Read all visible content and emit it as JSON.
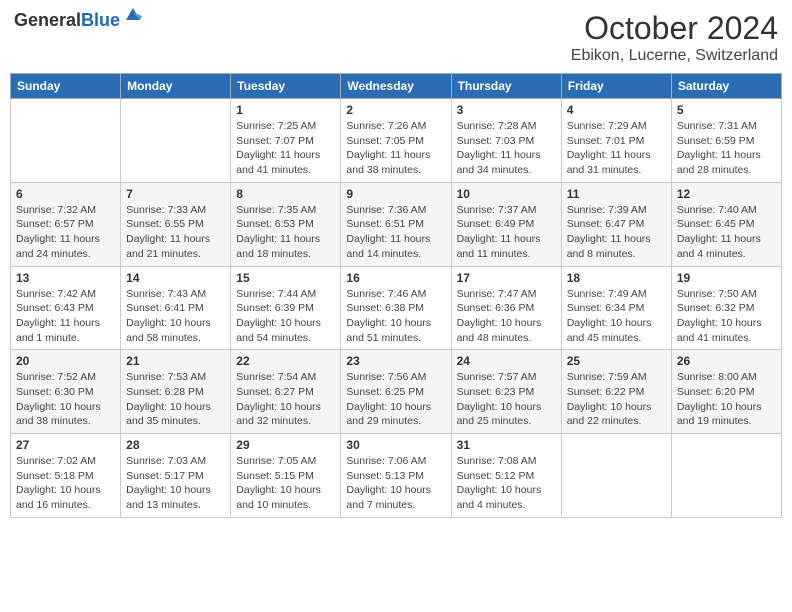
{
  "header": {
    "logo_general": "General",
    "logo_blue": "Blue",
    "month": "October 2024",
    "location": "Ebikon, Lucerne, Switzerland"
  },
  "weekdays": [
    "Sunday",
    "Monday",
    "Tuesday",
    "Wednesday",
    "Thursday",
    "Friday",
    "Saturday"
  ],
  "weeks": [
    [
      {
        "day": "",
        "sunrise": "",
        "sunset": "",
        "daylight": ""
      },
      {
        "day": "",
        "sunrise": "",
        "sunset": "",
        "daylight": ""
      },
      {
        "day": "1",
        "sunrise": "Sunrise: 7:25 AM",
        "sunset": "Sunset: 7:07 PM",
        "daylight": "Daylight: 11 hours and 41 minutes."
      },
      {
        "day": "2",
        "sunrise": "Sunrise: 7:26 AM",
        "sunset": "Sunset: 7:05 PM",
        "daylight": "Daylight: 11 hours and 38 minutes."
      },
      {
        "day": "3",
        "sunrise": "Sunrise: 7:28 AM",
        "sunset": "Sunset: 7:03 PM",
        "daylight": "Daylight: 11 hours and 34 minutes."
      },
      {
        "day": "4",
        "sunrise": "Sunrise: 7:29 AM",
        "sunset": "Sunset: 7:01 PM",
        "daylight": "Daylight: 11 hours and 31 minutes."
      },
      {
        "day": "5",
        "sunrise": "Sunrise: 7:31 AM",
        "sunset": "Sunset: 6:59 PM",
        "daylight": "Daylight: 11 hours and 28 minutes."
      }
    ],
    [
      {
        "day": "6",
        "sunrise": "Sunrise: 7:32 AM",
        "sunset": "Sunset: 6:57 PM",
        "daylight": "Daylight: 11 hours and 24 minutes."
      },
      {
        "day": "7",
        "sunrise": "Sunrise: 7:33 AM",
        "sunset": "Sunset: 6:55 PM",
        "daylight": "Daylight: 11 hours and 21 minutes."
      },
      {
        "day": "8",
        "sunrise": "Sunrise: 7:35 AM",
        "sunset": "Sunset: 6:53 PM",
        "daylight": "Daylight: 11 hours and 18 minutes."
      },
      {
        "day": "9",
        "sunrise": "Sunrise: 7:36 AM",
        "sunset": "Sunset: 6:51 PM",
        "daylight": "Daylight: 11 hours and 14 minutes."
      },
      {
        "day": "10",
        "sunrise": "Sunrise: 7:37 AM",
        "sunset": "Sunset: 6:49 PM",
        "daylight": "Daylight: 11 hours and 11 minutes."
      },
      {
        "day": "11",
        "sunrise": "Sunrise: 7:39 AM",
        "sunset": "Sunset: 6:47 PM",
        "daylight": "Daylight: 11 hours and 8 minutes."
      },
      {
        "day": "12",
        "sunrise": "Sunrise: 7:40 AM",
        "sunset": "Sunset: 6:45 PM",
        "daylight": "Daylight: 11 hours and 4 minutes."
      }
    ],
    [
      {
        "day": "13",
        "sunrise": "Sunrise: 7:42 AM",
        "sunset": "Sunset: 6:43 PM",
        "daylight": "Daylight: 11 hours and 1 minute."
      },
      {
        "day": "14",
        "sunrise": "Sunrise: 7:43 AM",
        "sunset": "Sunset: 6:41 PM",
        "daylight": "Daylight: 10 hours and 58 minutes."
      },
      {
        "day": "15",
        "sunrise": "Sunrise: 7:44 AM",
        "sunset": "Sunset: 6:39 PM",
        "daylight": "Daylight: 10 hours and 54 minutes."
      },
      {
        "day": "16",
        "sunrise": "Sunrise: 7:46 AM",
        "sunset": "Sunset: 6:38 PM",
        "daylight": "Daylight: 10 hours and 51 minutes."
      },
      {
        "day": "17",
        "sunrise": "Sunrise: 7:47 AM",
        "sunset": "Sunset: 6:36 PM",
        "daylight": "Daylight: 10 hours and 48 minutes."
      },
      {
        "day": "18",
        "sunrise": "Sunrise: 7:49 AM",
        "sunset": "Sunset: 6:34 PM",
        "daylight": "Daylight: 10 hours and 45 minutes."
      },
      {
        "day": "19",
        "sunrise": "Sunrise: 7:50 AM",
        "sunset": "Sunset: 6:32 PM",
        "daylight": "Daylight: 10 hours and 41 minutes."
      }
    ],
    [
      {
        "day": "20",
        "sunrise": "Sunrise: 7:52 AM",
        "sunset": "Sunset: 6:30 PM",
        "daylight": "Daylight: 10 hours and 38 minutes."
      },
      {
        "day": "21",
        "sunrise": "Sunrise: 7:53 AM",
        "sunset": "Sunset: 6:28 PM",
        "daylight": "Daylight: 10 hours and 35 minutes."
      },
      {
        "day": "22",
        "sunrise": "Sunrise: 7:54 AM",
        "sunset": "Sunset: 6:27 PM",
        "daylight": "Daylight: 10 hours and 32 minutes."
      },
      {
        "day": "23",
        "sunrise": "Sunrise: 7:56 AM",
        "sunset": "Sunset: 6:25 PM",
        "daylight": "Daylight: 10 hours and 29 minutes."
      },
      {
        "day": "24",
        "sunrise": "Sunrise: 7:57 AM",
        "sunset": "Sunset: 6:23 PM",
        "daylight": "Daylight: 10 hours and 25 minutes."
      },
      {
        "day": "25",
        "sunrise": "Sunrise: 7:59 AM",
        "sunset": "Sunset: 6:22 PM",
        "daylight": "Daylight: 10 hours and 22 minutes."
      },
      {
        "day": "26",
        "sunrise": "Sunrise: 8:00 AM",
        "sunset": "Sunset: 6:20 PM",
        "daylight": "Daylight: 10 hours and 19 minutes."
      }
    ],
    [
      {
        "day": "27",
        "sunrise": "Sunrise: 7:02 AM",
        "sunset": "Sunset: 5:18 PM",
        "daylight": "Daylight: 10 hours and 16 minutes."
      },
      {
        "day": "28",
        "sunrise": "Sunrise: 7:03 AM",
        "sunset": "Sunset: 5:17 PM",
        "daylight": "Daylight: 10 hours and 13 minutes."
      },
      {
        "day": "29",
        "sunrise": "Sunrise: 7:05 AM",
        "sunset": "Sunset: 5:15 PM",
        "daylight": "Daylight: 10 hours and 10 minutes."
      },
      {
        "day": "30",
        "sunrise": "Sunrise: 7:06 AM",
        "sunset": "Sunset: 5:13 PM",
        "daylight": "Daylight: 10 hours and 7 minutes."
      },
      {
        "day": "31",
        "sunrise": "Sunrise: 7:08 AM",
        "sunset": "Sunset: 5:12 PM",
        "daylight": "Daylight: 10 hours and 4 minutes."
      },
      {
        "day": "",
        "sunrise": "",
        "sunset": "",
        "daylight": ""
      },
      {
        "day": "",
        "sunrise": "",
        "sunset": "",
        "daylight": ""
      }
    ]
  ]
}
